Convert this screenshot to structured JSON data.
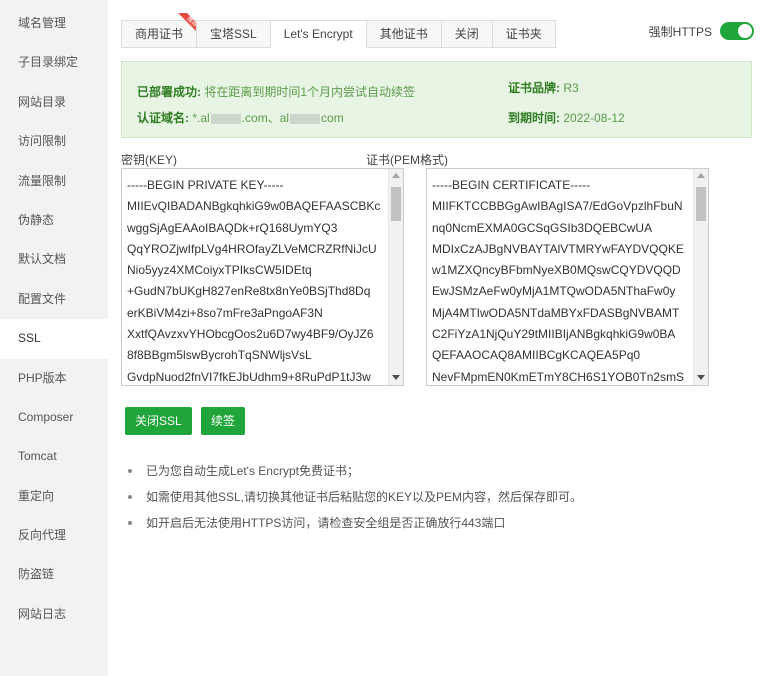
{
  "sidebar": {
    "items": [
      {
        "label": "域名管理"
      },
      {
        "label": "子目录绑定"
      },
      {
        "label": "网站目录"
      },
      {
        "label": "访问限制"
      },
      {
        "label": "流量限制"
      },
      {
        "label": "伪静态"
      },
      {
        "label": "默认文档"
      },
      {
        "label": "配置文件"
      },
      {
        "label": "SSL"
      },
      {
        "label": "PHP版本"
      },
      {
        "label": "Composer"
      },
      {
        "label": "Tomcat"
      },
      {
        "label": "重定向"
      },
      {
        "label": "反向代理"
      },
      {
        "label": "防盗链"
      },
      {
        "label": "网站日志"
      }
    ],
    "active": "SSL"
  },
  "tabs": [
    {
      "label": "商用证书",
      "badge": "推荐"
    },
    {
      "label": "宝塔SSL"
    },
    {
      "label": "Let's Encrypt",
      "active": true
    },
    {
      "label": "其他证书"
    },
    {
      "label": "关闭"
    },
    {
      "label": "证书夹"
    }
  ],
  "force_https": {
    "label": "强制HTTPS",
    "enabled": true
  },
  "status": {
    "deployed_label": "已部署成功:",
    "deployed_text": "将在距离到期时间1个月内尝试自动续签",
    "domains_label": "认证域名:",
    "domain_prefix_1": "*.al",
    "domain_suffix_1": ".com、al",
    "domain_suffix_2": "com",
    "brand_label": "证书品牌:",
    "brand_value": "R3",
    "expiry_label": "到期时间:",
    "expiry_value": "2022-08-12"
  },
  "key": {
    "label": "密钥(KEY)",
    "lines": [
      "-----BEGIN PRIVATE KEY-----",
      "MIIEvQIBADANBgkqhkiG9w0BAQEFAASCBKc",
      "wggSjAgEAAoIBAQDk+rQ168UymYQ3",
      "QqYROZjwIfpLVg4HROfayZLVeMCRZRfNiJcU",
      "Nio5yyz4XMCoiyxTPIksCW5IDEtq",
      "+GudN7bUKgH827enRe8tx8nYe0BSjThd8Dq",
      "erKBiVM4zi+8so7mFre3aPngoAF3N",
      "XxtfQAvzxvYHObcgOos2u6D7wy4BF9/OyJZ6",
      "8f8BBgm5lswBycrohTqSNWljsVsL",
      "GvdpNuod2fnVI7fkEJbUdhm9+8RuPdP1tJ3w"
    ]
  },
  "cert": {
    "label": "证书(PEM格式)",
    "lines": [
      "-----BEGIN CERTIFICATE-----",
      "MIIFKTCCBBGgAwIBAgISA7/EdGoVpzlhFbuN",
      "nq0NcmEXMA0GCSqGSIb3DQEBCwUA",
      "MDIxCzAJBgNVBAYTAlVTMRYwFAYDVQQKE",
      "w1MZXQncyBFbmNyeXB0MQswCQYDVQQD",
      "EwJSMzAeFw0yMjA1MTQwODA5NThaFw0y",
      "MjA4MTIwODA5NTdaMBYxFDASBgNVBAMT",
      "C2FiYzA1NjQuY29tMIIBIjANBgkqhkiG9w0BA",
      "QEFAAOCAQ8AMIIBCgKCAQEA5Pq0",
      "NevFMpmEN0KmETmY8CH6S1YOB0Tn2smS"
    ]
  },
  "buttons": {
    "close_ssl": "关闭SSL",
    "renew": "续签"
  },
  "tips": [
    "已为您自动生成Let's Encrypt免费证书；",
    "如需使用其他SSL,请切换其他证书后粘贴您的KEY以及PEM内容，然后保存即可。",
    "如开启后无法使用HTTPS访问，请检查安全组是否正确放行443端口"
  ],
  "colors": {
    "accent": "#20a53a",
    "status_bg": "#e8f5e4",
    "badge": "#e54d42"
  }
}
